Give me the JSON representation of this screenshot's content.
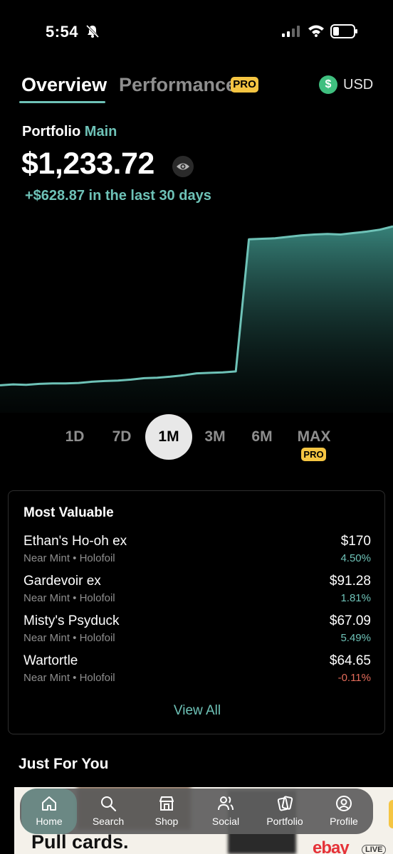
{
  "status_bar": {
    "time": "5:54"
  },
  "header": {
    "tab_overview": "Overview",
    "tab_performance": "Performance",
    "pro_badge": "PRO",
    "currency_symbol": "$",
    "currency": "USD"
  },
  "portfolio": {
    "label": "Portfolio",
    "name": "Main",
    "value": "$1,233.72",
    "change": "+$628.87 in the last 30 days"
  },
  "chart_data": {
    "type": "area",
    "x": [
      0,
      1,
      2,
      3,
      4,
      5,
      6,
      7,
      8,
      9,
      10,
      11,
      12,
      13,
      14,
      15,
      16,
      17,
      18,
      19,
      20,
      21,
      22,
      23,
      24,
      25,
      26,
      27,
      28,
      29,
      30
    ],
    "values": [
      570,
      574,
      572,
      576,
      578,
      578,
      580,
      585,
      588,
      590,
      594,
      600,
      602,
      606,
      612,
      620,
      622,
      624,
      628,
      1180,
      1182,
      1184,
      1190,
      1196,
      1200,
      1202,
      1200,
      1206,
      1212,
      1220,
      1233.72
    ],
    "line_color": "#6ec2b7"
  },
  "ranges": {
    "r1d": "1D",
    "r7d": "7D",
    "r1m": "1M",
    "r3m": "3M",
    "r6m": "6M",
    "rmax": "MAX",
    "pro": "PRO",
    "selected": "1M"
  },
  "most_valuable": {
    "title": "Most Valuable",
    "items": [
      {
        "name": "Ethan's Ho-oh ex",
        "condition": "Near Mint • Holofoil",
        "price": "$170",
        "change": "4.50%"
      },
      {
        "name": "Gardevoir ex",
        "condition": "Near Mint • Holofoil",
        "price": "$91.28",
        "change": "1.81%"
      },
      {
        "name": "Misty's Psyduck",
        "condition": "Near Mint • Holofoil",
        "price": "$67.09",
        "change": "5.49%"
      },
      {
        "name": "Wartortle",
        "condition": "Near Mint • Holofoil",
        "price": "$64.65",
        "change": "-0.11%"
      }
    ],
    "view_all": "View All"
  },
  "just_for_you": {
    "title": "Just For You"
  },
  "promo": {
    "text": "Pull cards.",
    "brand": "ebay",
    "live": "LIVE"
  },
  "nav": {
    "home": "Home",
    "search": "Search",
    "shop": "Shop",
    "social": "Social",
    "portfolio": "Portfolio",
    "profile": "Profile"
  },
  "colors": {
    "accent": "#6ec2b7",
    "negative": "#e36b5a",
    "pro": "#f5c542"
  }
}
